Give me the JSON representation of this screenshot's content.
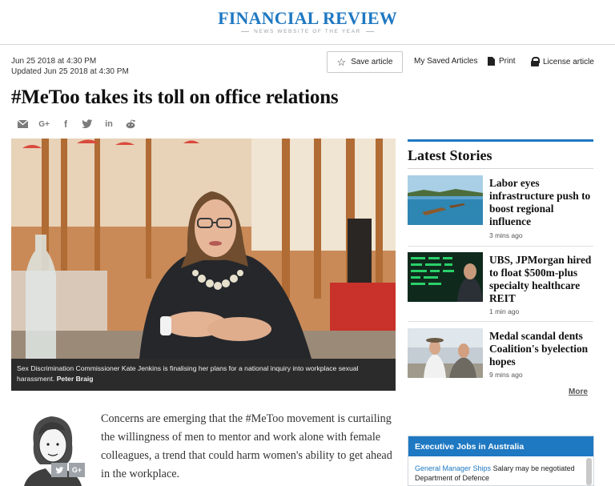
{
  "masthead": {
    "title": "FINANCIAL REVIEW",
    "tagline": "NEWS WEBSITE OF THE YEAR"
  },
  "article": {
    "published": "Jun 25 2018 at 4:30 PM",
    "updated": "Updated Jun 25 2018 at 4:30 PM",
    "headline": "#MeToo takes its toll on office relations",
    "caption": "Sex Discrimination Commissioner Kate Jenkins is finalising her plans for a national inquiry into workplace sexual harassment.",
    "photo_credit": "Peter Braig",
    "intro": "Concerns are emerging that the #MeToo movement is curtailing the willingness of men to mentor and work alone with female colleagues, a trend that could harm women's ability to get ahead in the workplace."
  },
  "toolbar": {
    "save_label": "Save article",
    "saved_label": "My Saved Articles",
    "print_label": "Print",
    "license_label": "License article"
  },
  "share_icons": [
    "email-icon",
    "google-plus-icon",
    "facebook-icon",
    "twitter-icon",
    "linkedin-icon",
    "reddit-icon"
  ],
  "author_social": {
    "twitter": "twitter-icon",
    "google": "G+"
  },
  "sidebar": {
    "latest_title": "Latest Stories",
    "stories": [
      {
        "title": "Labor eyes infrastructure push to boost regional influence",
        "time": "3 mins ago"
      },
      {
        "title": "UBS, JPMorgan hired to float $500m-plus specialty healthcare REIT",
        "time": "1 min ago"
      },
      {
        "title": "Medal scandal dents Coalition's byelection hopes",
        "time": "9 mins ago"
      }
    ],
    "more_label": "More"
  },
  "jobs": {
    "title": "Executive Jobs in Australia",
    "listing_title": "General Manager Ships",
    "listing_salary": "Salary may be negotiated",
    "listing_employer": "Department of Defence"
  },
  "colors": {
    "brand_blue": "#1e78c2",
    "caption_bg": "#2b2b2b"
  }
}
